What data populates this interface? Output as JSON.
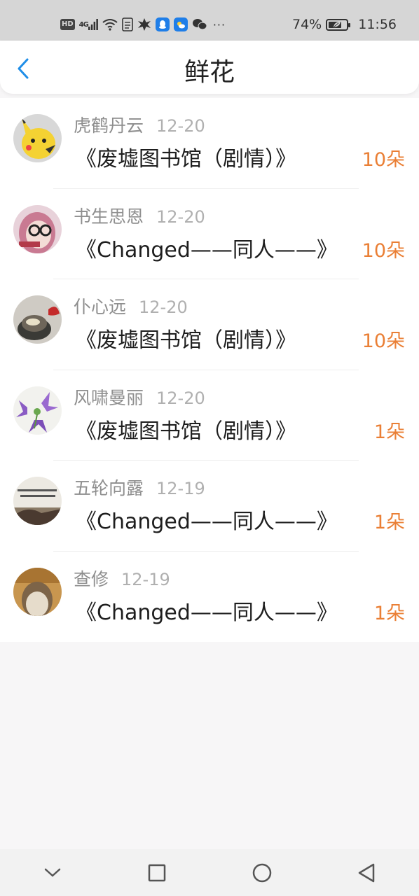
{
  "status_bar": {
    "hd_label": "HD",
    "network_label": "4G",
    "battery_percent": "74%",
    "battery_level": 0.74,
    "time": "11:56",
    "icons": [
      "hd-icon",
      "signal-icon",
      "wifi-icon",
      "document-icon",
      "explosion-app-icon",
      "qq-icon",
      "weather-icon",
      "wechat-icon",
      "more-dots-icon"
    ]
  },
  "header": {
    "title": "鲜花",
    "back_icon": "chevron-left-icon"
  },
  "records": [
    {
      "user": "虎鹤丹云",
      "date": "12-20",
      "book": "《废墟图书馆（剧情）》",
      "flowers": "10朵",
      "avatar_color": "#f4d233"
    },
    {
      "user": "书生思恩",
      "date": "12-20",
      "book": "《Changed——同人——》",
      "flowers": "10朵",
      "avatar_color": "#c97a92"
    },
    {
      "user": "仆心远",
      "date": "12-20",
      "book": "《废墟图书馆（剧情）》",
      "flowers": "10朵",
      "avatar_color": "#6e665a"
    },
    {
      "user": "风啸曼丽",
      "date": "12-20",
      "book": "《废墟图书馆（剧情）》",
      "flowers": "1朵",
      "avatar_color": "#8a5cc4"
    },
    {
      "user": "五轮向露",
      "date": "12-19",
      "book": "《Changed——同人——》",
      "flowers": "1朵",
      "avatar_color": "#8a7a66"
    },
    {
      "user": "查修",
      "date": "12-19",
      "book": "《Changed——同人——》",
      "flowers": "1朵",
      "avatar_color": "#b58a4f"
    }
  ],
  "colors": {
    "flower_count": "#ea7f35",
    "accent_back": "#1f8ee8"
  },
  "nav": {
    "icons": [
      "chevron-down-icon",
      "recents-square-icon",
      "home-circle-icon",
      "back-triangle-icon"
    ]
  }
}
